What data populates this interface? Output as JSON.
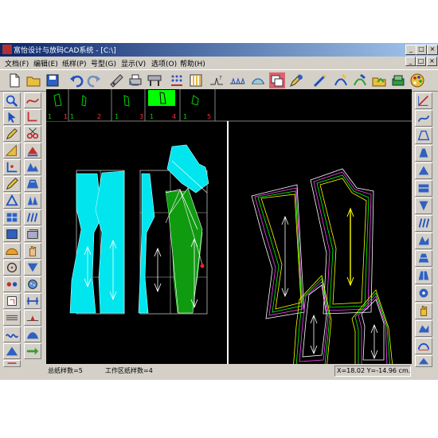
{
  "window": {
    "title": "富怡设计与放码CAD系统 - [C:\\]",
    "controls": [
      "_",
      "□",
      "×"
    ]
  },
  "menu": [
    "文档(F)",
    "编辑(E)",
    "纸样(P)",
    "号型(G)",
    "显示(V)",
    "选项(O)",
    "帮助(H)"
  ],
  "piece_strip": {
    "pieces": [
      {
        "count": "1",
        "number": "1"
      },
      {
        "count": "1",
        "number": "2"
      },
      {
        "count": "1",
        "number": "3"
      },
      {
        "count": "1",
        "number": "4"
      },
      {
        "count": "1",
        "number": "5"
      }
    ],
    "selected_index": 3
  },
  "status": {
    "total_label": "总纸样数=5",
    "work_label": "工作区纸样数=4",
    "coords": "X=18.02 Y=-14.96 cm."
  },
  "colors": {
    "canvas": "#000000",
    "piece_cyan": "#00e5ee",
    "piece_green": "#109a10",
    "selected_tab": "#00ff00",
    "chrome": "#d4d0c8"
  },
  "icons": {
    "toolbar": [
      "new-file-icon",
      "open-folder-icon",
      "save-icon",
      "undo-icon",
      "redo-icon",
      "measure-icon",
      "print-icon",
      "plotter-icon",
      "grid-icon",
      "grade-table-icon",
      "symmetry-icon",
      "notch-icon",
      "piece-icon",
      "stack-icon",
      "pen-icon",
      "curve-icon",
      "edit-icon",
      "folder-icon",
      "layers-icon",
      "palette-icon"
    ],
    "left": [
      "zoom-icon",
      "curve-tool-icon",
      "select-arrow-icon",
      "corner-icon",
      "pen-icon",
      "cut-icon",
      "ruler-icon",
      "tilt-icon",
      "axis-icon",
      "fold-icon",
      "pencil-icon",
      "pattern-icon",
      "triangle-icon",
      "fan-icon",
      "grid-cell-icon",
      "stripe-icon",
      "rect-icon",
      "layer-icon",
      "protractor-icon",
      "hand-icon",
      "circle-icon",
      "dart-icon",
      "rotate-icon",
      "button-icon",
      "piece-small-icon",
      "width-icon",
      "line-icon",
      "notch-tool-icon",
      "wave-icon",
      "seam-icon",
      "stack-tool-icon",
      "arrow-right-icon",
      "hook-icon",
      "marker-icon",
      "text-tool-icon",
      "shirt-icon"
    ],
    "right": [
      "ruler-icon",
      "curve-icon",
      "grade-icon",
      "notch-icon",
      "piece-icon",
      "stack-icon",
      "dart-icon",
      "stripe-icon",
      "fold-icon",
      "layer-icon",
      "pleat-icon",
      "grid-icon",
      "hand-icon",
      "magnify-icon",
      "rotate-icon",
      "seam-icon",
      "text-icon"
    ]
  }
}
